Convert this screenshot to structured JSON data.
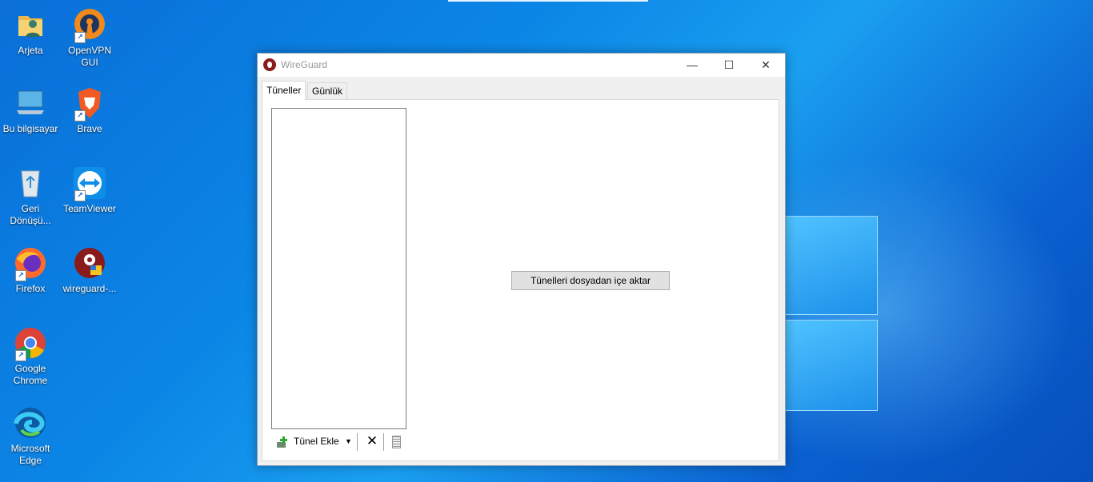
{
  "desktop": {
    "icons": [
      {
        "label": "Arjeta",
        "icon": "user-folder-icon"
      },
      {
        "label": "OpenVPN GUI",
        "icon": "openvpn-icon"
      },
      {
        "label": "Bu bilgisayar",
        "icon": "computer-icon"
      },
      {
        "label": "Brave",
        "icon": "brave-icon"
      },
      {
        "label": "Geri Dönüşü...",
        "icon": "recycle-bin-icon"
      },
      {
        "label": "TeamViewer",
        "icon": "teamviewer-icon"
      },
      {
        "label": "Firefox",
        "icon": "firefox-icon"
      },
      {
        "label": "wireguard-...",
        "icon": "wireguard-installer-icon"
      },
      {
        "label": "Google Chrome",
        "icon": "chrome-icon"
      },
      {
        "label": "Microsoft Edge",
        "icon": "edge-icon"
      }
    ]
  },
  "window": {
    "title": "WireGuard",
    "controls": {
      "minimize": "—",
      "maximize": "☐",
      "close": "✕"
    },
    "tabs": [
      {
        "label": "Tüneller",
        "active": true
      },
      {
        "label": "Günlük",
        "active": false
      }
    ],
    "toolbar": {
      "add_label": "Tünel Ekle",
      "add_dropdown": "▼",
      "delete_label": "✕"
    },
    "import_button": "Tünelleri dosyadan içe aktar"
  },
  "colors": {
    "desktop_blue": "#0b86e6",
    "wireguard_red": "#8b1a1a"
  }
}
